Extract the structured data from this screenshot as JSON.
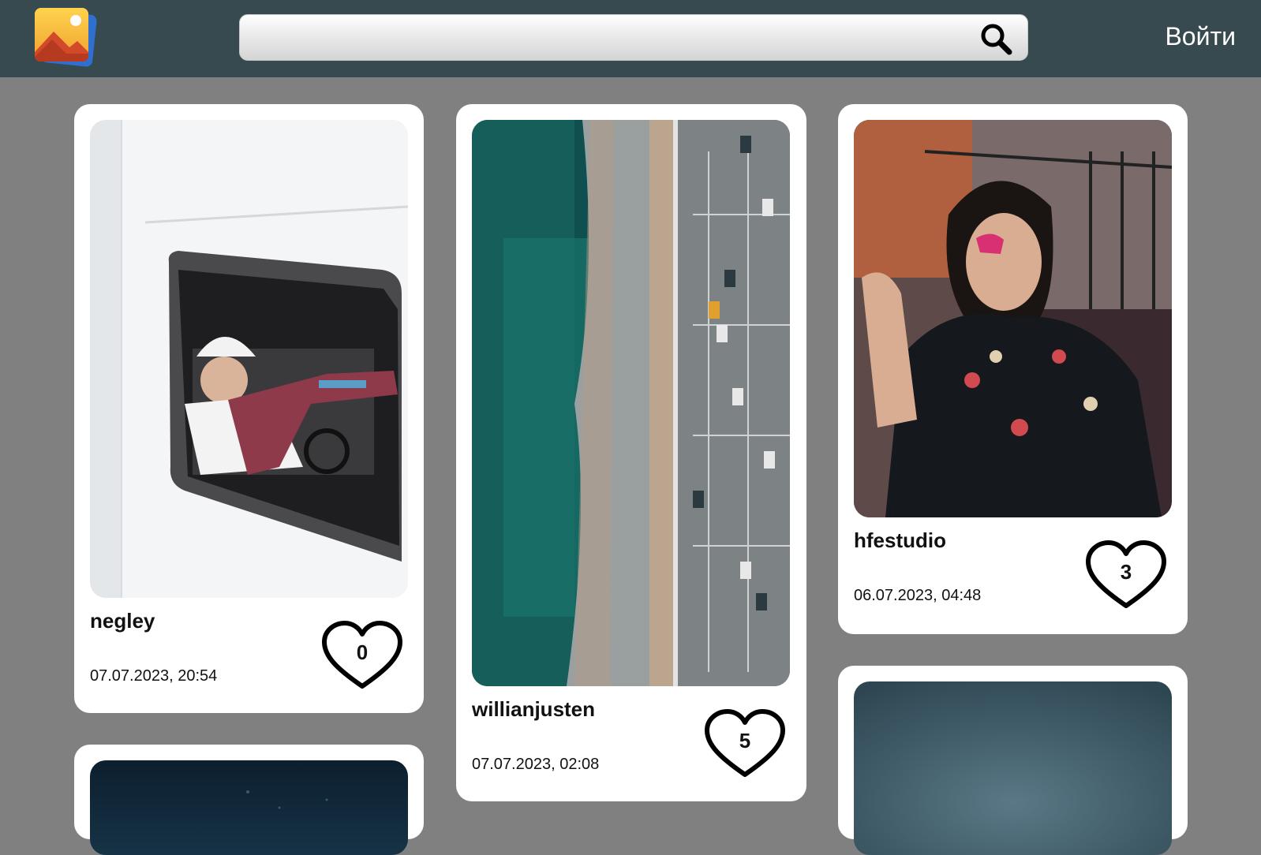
{
  "header": {
    "logo_icon": "gallery-image-icon",
    "search": {
      "value": "",
      "placeholder": "",
      "button_icon": "search-icon"
    },
    "login_label": "Войти",
    "bg_color": "#374a4f"
  },
  "feed": {
    "bg_color": "#808080",
    "posts": [
      {
        "author": "negley",
        "date": "07.07.2023, 20:54",
        "likes": "0",
        "photo": "person-in-van-window"
      },
      {
        "author": "willianjusten",
        "date": "07.07.2023, 02:08",
        "likes": "5",
        "photo": "aerial-coast-parking"
      },
      {
        "author": "hfestudio",
        "date": "06.07.2023, 04:48",
        "likes": "3",
        "photo": "woman-portrait-stairs"
      },
      {
        "author": "",
        "date": "",
        "likes": "",
        "photo": "dark-night-photo"
      },
      {
        "author": "",
        "date": "",
        "likes": "",
        "photo": "blue-gradient-photo"
      }
    ]
  }
}
